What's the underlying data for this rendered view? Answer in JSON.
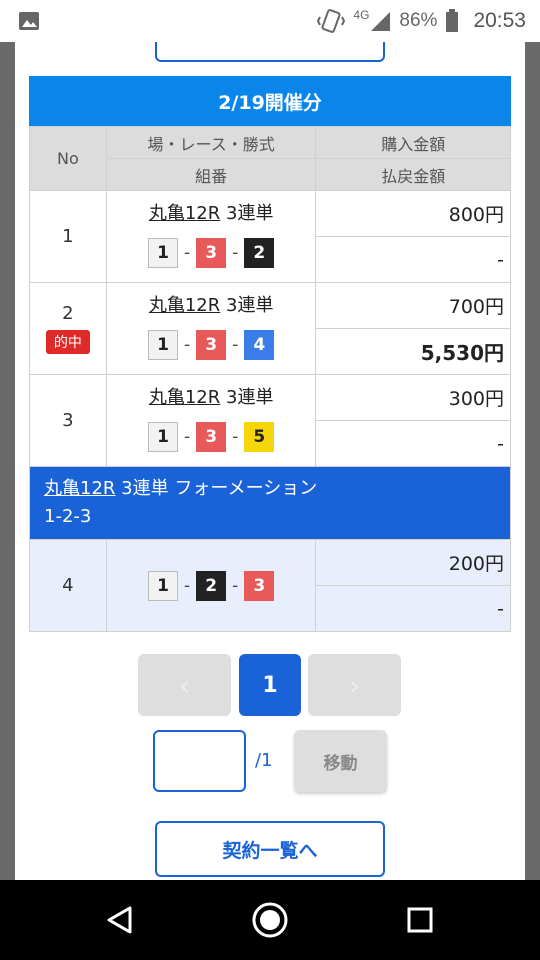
{
  "status_bar": {
    "network": "4G",
    "battery": "86%",
    "time": "20:53"
  },
  "header": {
    "date_title": "2/19開催分"
  },
  "table": {
    "headers": {
      "no": "No",
      "venue_race_type": "場・レース・勝式",
      "combination": "組番",
      "purchase_amount": "購入金額",
      "payout_amount": "払戻金額"
    },
    "rows": [
      {
        "no": "1",
        "venue": "丸亀12R",
        "bet_type": "3連単",
        "combo": [
          "1",
          "3",
          "2"
        ],
        "purchase": "800円",
        "payout": "-",
        "hit": ""
      },
      {
        "no": "2",
        "venue": "丸亀12R",
        "bet_type": "3連単",
        "combo": [
          "1",
          "3",
          "4"
        ],
        "purchase": "700円",
        "payout": "5,530円",
        "hit": "的中"
      },
      {
        "no": "3",
        "venue": "丸亀12R",
        "bet_type": "3連単",
        "combo": [
          "1",
          "3",
          "5"
        ],
        "purchase": "300円",
        "payout": "-",
        "hit": ""
      }
    ],
    "formation": {
      "venue": "丸亀12R",
      "label": "3連単 フォーメーション",
      "combo_text": "1-2-3"
    },
    "formation_row": {
      "no": "4",
      "combo": [
        "1",
        "2",
        "3"
      ],
      "purchase": "200円",
      "payout": "-"
    }
  },
  "pagination": {
    "prev_icon": "chevron-left-icon",
    "current_page": "1",
    "next_icon": "chevron-right-icon",
    "page_input_value": "",
    "total_pages": "/1",
    "move_label": "移動"
  },
  "footer": {
    "contract_list_label": "契約一覧へ"
  },
  "colors": {
    "accent": "#1a62d8",
    "header_blue": "#0a86ea",
    "hit_red": "#e02a2a"
  }
}
